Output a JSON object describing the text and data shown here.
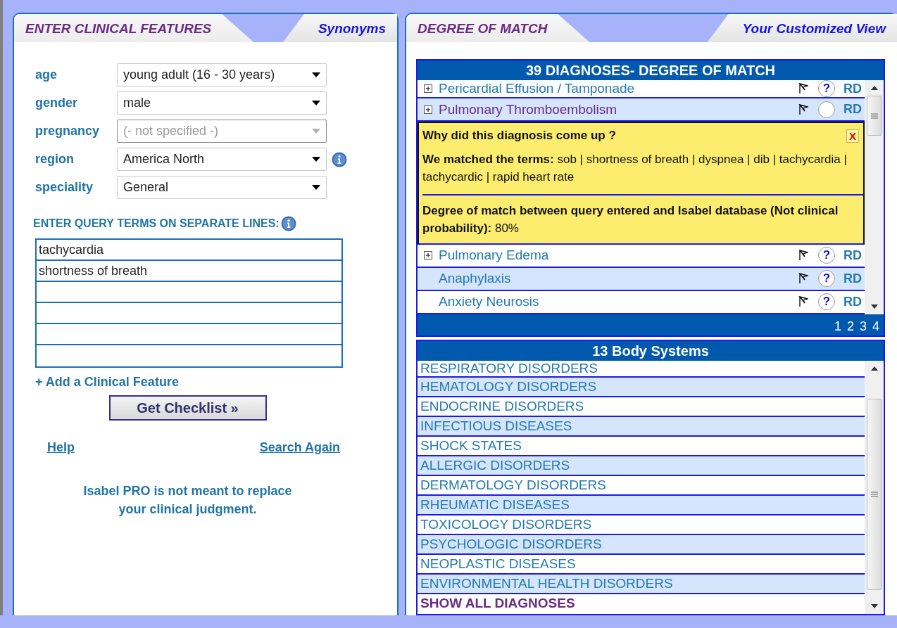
{
  "left_panel": {
    "tabs": [
      {
        "label": "ENTER CLINICAL FEATURES",
        "selected": true
      },
      {
        "label": "Synonyms",
        "selected": false
      }
    ],
    "fields": [
      {
        "label": "age",
        "value": "young adult (16 - 30 years)",
        "disabled": false,
        "info": false
      },
      {
        "label": "gender",
        "value": "male",
        "disabled": false,
        "info": false
      },
      {
        "label": "pregnancy",
        "value": "(- not specified -)",
        "disabled": true,
        "info": false
      },
      {
        "label": "region",
        "value": "America North",
        "disabled": false,
        "info": true
      },
      {
        "label": "speciality",
        "value": "General",
        "disabled": false,
        "info": false
      }
    ],
    "query_heading": "ENTER QUERY TERMS ON SEPARATE LINES:",
    "query_terms": [
      "tachycardia",
      "shortness of breath"
    ],
    "add_link": "+ Add a Clinical Feature",
    "submit_button": "Get Checklist »",
    "links": [
      "Help",
      "Search Again"
    ],
    "disclaimer": "Isabel PRO is not meant to replace your clinical judgment."
  },
  "right_panel": {
    "tabs": [
      {
        "label": "DEGREE OF MATCH",
        "selected": true
      },
      {
        "label": "Your Customized View",
        "selected": false
      }
    ],
    "diagnoses": {
      "title": "39  DIAGNOSES- DEGREE OF MATCH",
      "rows": [
        {
          "name": "Pericardial Effusion / Tamponade",
          "expandable": true,
          "selected": false,
          "help": "?",
          "link": "RD"
        },
        {
          "name": "Pulmonary Thromboembolism",
          "expandable": true,
          "selected": true,
          "link": "RD"
        },
        {
          "name": "Pulmonary Edema",
          "expandable": true,
          "selected": false,
          "help": "?",
          "link": "RD"
        },
        {
          "name": "Anaphylaxis",
          "expandable": false,
          "selected": false,
          "help": "?",
          "link": "RD"
        },
        {
          "name": "Anxiety Neurosis",
          "expandable": false,
          "selected": false,
          "help": "?",
          "link": "RD"
        }
      ],
      "popup": {
        "title": "Why did this diagnosis come up ?",
        "close": "X",
        "matched": "**We matched the terms:** sob | shortness of breath | dyspnea | dib | tachycardia | tachycardic | rapid heart rate",
        "degree": "**Degree of match between query entered and Isabel database (Not clinical probability):** 80%"
      },
      "pages": [
        "1",
        "2",
        "3",
        "4"
      ]
    },
    "body_systems": {
      "title": "13 Body Systems",
      "items": [
        "RESPIRATORY DISORDERS",
        "HEMATOLOGY DISORDERS",
        "ENDOCRINE DISORDERS",
        "INFECTIOUS DISEASES",
        "SHOCK STATES",
        "ALLERGIC DISORDERS",
        "DERMATOLOGY DISORDERS",
        "RHEUMATIC DISEASES",
        "TOXICOLOGY DISORDERS",
        "PSYCHOLOGIC DISORDERS",
        "NEOPLASTIC DISEASES",
        "ENVIRONMENTAL HEALTH DISORDERS"
      ],
      "show_all": "SHOW ALL DIAGNOSES"
    }
  }
}
